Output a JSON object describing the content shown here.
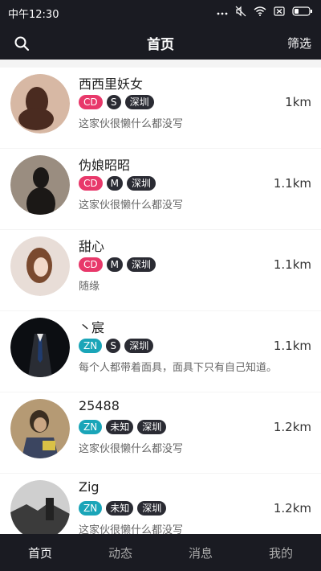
{
  "status_bar": {
    "time": "中午12:30"
  },
  "header": {
    "title": "首页",
    "filter_label": "筛选"
  },
  "users": [
    {
      "name": "西西里妖女",
      "tag_type": "CD",
      "tag_color": "#e8386a",
      "zodiac": "S",
      "city": "深圳",
      "distance": "1km",
      "bio": "这家伙很懒什么都没写",
      "avatar_colors": [
        "#d7b8a4",
        "#4a2b20"
      ]
    },
    {
      "name": "伪娘昭昭",
      "tag_type": "CD",
      "tag_color": "#e8386a",
      "zodiac": "M",
      "city": "深圳",
      "distance": "1.1km",
      "bio": "这家伙很懒什么都没写",
      "avatar_colors": [
        "#9a8d80",
        "#1b1816"
      ]
    },
    {
      "name": "甜心",
      "tag_type": "CD",
      "tag_color": "#e8386a",
      "zodiac": "M",
      "city": "深圳",
      "distance": "1.1km",
      "bio": "随缘",
      "avatar_colors": [
        "#e8ddd7",
        "#7a4a2f"
      ]
    },
    {
      "name": "丶宸",
      "tag_type": "ZN",
      "tag_color": "#1aa5b8",
      "zodiac": "S",
      "city": "深圳",
      "distance": "1.1km",
      "bio": "每个人都带着面具，面具下只有自己知道。",
      "avatar_colors": [
        "#2a2d34",
        "#0c0e12"
      ]
    },
    {
      "name": "25488",
      "tag_type": "ZN",
      "tag_color": "#1aa5b8",
      "zodiac": "未知",
      "city": "深圳",
      "distance": "1.2km",
      "bio": "这家伙很懒什么都没写",
      "avatar_colors": [
        "#b59a74",
        "#3a2d20"
      ]
    },
    {
      "name": "Zig",
      "tag_type": "ZN",
      "tag_color": "#1aa5b8",
      "zodiac": "未知",
      "city": "深圳",
      "distance": "1.2km",
      "bio": "这家伙很懒什么都没写",
      "avatar_colors": [
        "#cfcfcf",
        "#3b3b3b"
      ]
    }
  ],
  "tabs": [
    {
      "label": "首页",
      "active": true
    },
    {
      "label": "动态",
      "active": false
    },
    {
      "label": "消息",
      "active": false
    },
    {
      "label": "我的",
      "active": false
    }
  ]
}
